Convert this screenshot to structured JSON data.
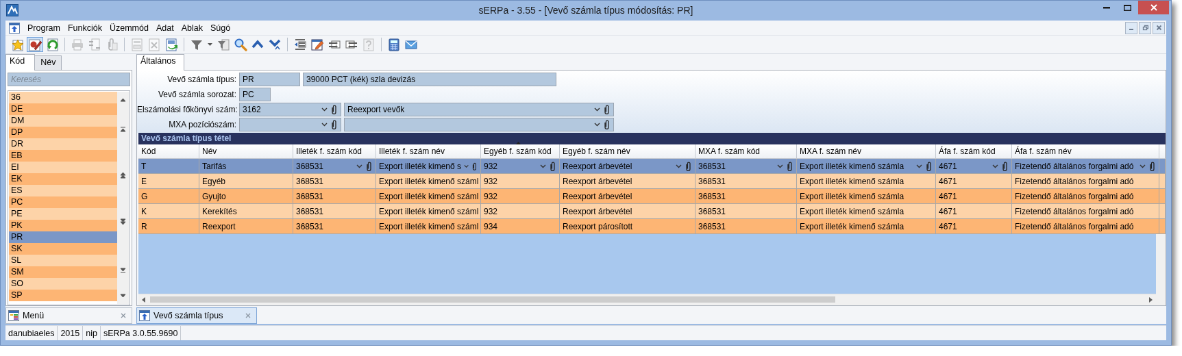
{
  "window": {
    "title": "sERPa - 3.55 - [Vevő számla típus módosítás: PR]"
  },
  "menu": [
    {
      "label": "Program"
    },
    {
      "label": "Funkciók"
    },
    {
      "label": "Üzemmód"
    },
    {
      "label": "Adat"
    },
    {
      "label": "Ablak"
    },
    {
      "label": "Súgó"
    }
  ],
  "toolbar": [
    [
      {
        "kind": "star",
        "disabled": false,
        "pressed": false
      },
      {
        "kind": "edit",
        "disabled": false,
        "pressed": true
      },
      {
        "kind": "refresh",
        "disabled": false,
        "pressed": false
      }
    ],
    [
      {
        "kind": "print",
        "disabled": true,
        "pressed": false
      },
      {
        "kind": "doc-arrows",
        "disabled": true,
        "pressed": false
      },
      {
        "kind": "clip",
        "disabled": true,
        "pressed": false
      }
    ],
    [
      {
        "kind": "form",
        "disabled": true,
        "pressed": false
      },
      {
        "kind": "doc-x",
        "disabled": true,
        "pressed": false
      },
      {
        "kind": "doc-green",
        "disabled": false,
        "pressed": false
      }
    ],
    [
      {
        "kind": "filter",
        "disabled": false,
        "pressed": false
      },
      {
        "kind": "caret",
        "disabled": false,
        "pressed": false
      },
      {
        "kind": "filter-page",
        "disabled": false,
        "pressed": false
      },
      {
        "kind": "search",
        "disabled": false,
        "pressed": false
      },
      {
        "kind": "up",
        "disabled": false,
        "pressed": false
      },
      {
        "kind": "down",
        "disabled": false,
        "pressed": false
      }
    ],
    [
      {
        "kind": "outdent",
        "disabled": false,
        "pressed": false
      },
      {
        "kind": "note",
        "disabled": false,
        "pressed": false
      },
      {
        "kind": "move-in",
        "disabled": false,
        "pressed": false
      },
      {
        "kind": "move-out",
        "disabled": false,
        "pressed": false
      },
      {
        "kind": "help",
        "disabled": true,
        "pressed": false
      }
    ],
    [
      {
        "kind": "calculator",
        "disabled": false,
        "pressed": false
      },
      {
        "kind": "mail",
        "disabled": false,
        "pressed": false
      }
    ]
  ],
  "sidebar": {
    "tabs": [
      {
        "label": "Kód",
        "selected": true
      },
      {
        "label": "Név",
        "selected": false
      }
    ],
    "search": {
      "placeholder": "Keresés"
    },
    "items": [
      {
        "label": "36",
        "selected": false
      },
      {
        "label": "DE",
        "selected": false
      },
      {
        "label": "DM",
        "selected": false
      },
      {
        "label": "DP",
        "selected": false
      },
      {
        "label": "DR",
        "selected": false
      },
      {
        "label": "EB",
        "selected": false
      },
      {
        "label": "EI",
        "selected": false
      },
      {
        "label": "EK",
        "selected": false
      },
      {
        "label": "ES",
        "selected": false
      },
      {
        "label": "PC",
        "selected": false
      },
      {
        "label": "PE",
        "selected": false
      },
      {
        "label": "PK",
        "selected": false
      },
      {
        "label": "PR",
        "selected": true
      },
      {
        "label": "SK",
        "selected": false
      },
      {
        "label": "SL",
        "selected": false
      },
      {
        "label": "SM",
        "selected": false
      },
      {
        "label": "SO",
        "selected": false
      },
      {
        "label": "SP",
        "selected": false
      }
    ]
  },
  "form": {
    "tabs": [
      {
        "label": "Általános",
        "selected": true
      }
    ],
    "fields": [
      {
        "label": "Vevő számla típus:",
        "inputs": [
          {
            "kind": "text",
            "value": "PR"
          },
          {
            "kind": "text",
            "value": "39000 PCT (kék) szla devizás"
          }
        ]
      },
      {
        "label": "Vevő számla sorozat:",
        "inputs": [
          {
            "kind": "text",
            "value": "PC"
          }
        ]
      },
      {
        "label": "Elszámolási főkönyvi szám:",
        "inputs": [
          {
            "kind": "lookup",
            "value": "3162"
          },
          {
            "kind": "lookup",
            "value": "Reexport vevők"
          }
        ]
      },
      {
        "label": "MXA pozíciószám:",
        "inputs": [
          {
            "kind": "lookup"
          },
          {
            "kind": "lookup"
          }
        ]
      }
    ]
  },
  "table": {
    "title": "Vevő számla típus tétel",
    "columns": [
      {
        "label": "Kód",
        "kind": "text",
        "sorted": false
      },
      {
        "label": "Név",
        "kind": "text",
        "sorted": false
      },
      {
        "label": "Illeték f. szám kód",
        "kind": "lookup",
        "sorted": false
      },
      {
        "label": "Illeték f. szám név",
        "kind": "lookup",
        "sorted": false
      },
      {
        "label": "Egyéb f. szám kód",
        "kind": "lookup",
        "sorted": true
      },
      {
        "label": "Egyéb f. szám név",
        "kind": "lookup",
        "sorted": false
      },
      {
        "label": "MXA f. szám kód",
        "kind": "lookup",
        "sorted": false
      },
      {
        "label": "MXA f. szám név",
        "kind": "lookup",
        "sorted": false
      },
      {
        "label": "Áfa f. szám kód",
        "kind": "lookup",
        "sorted": false
      },
      {
        "label": "Áfa f. szám név",
        "kind": "lookup",
        "sorted": false
      }
    ],
    "rows": [
      {
        "selected": true,
        "cells": [
          "T",
          "Tarifás",
          "368531",
          "Export illeték kimenő s",
          "932",
          "Reexport árbevétel",
          "368531",
          "Export illeték kimenő számla",
          "4671",
          "Fizetendő általános forgalmi adó"
        ]
      },
      {
        "selected": false,
        "cells": [
          "E",
          "Egyéb",
          "368531",
          "Export illeték kimenő száml",
          "932",
          "Reexport árbevétel",
          "368531",
          "Export illeték kimenő számla",
          "4671",
          "Fizetendő általános forgalmi adó"
        ]
      },
      {
        "selected": false,
        "cells": [
          "G",
          "Gyujto",
          "368531",
          "Export illeték kimenő száml",
          "932",
          "Reexport árbevétel",
          "368531",
          "Export illeték kimenő számla",
          "4671",
          "Fizetendő általános forgalmi adó"
        ]
      },
      {
        "selected": false,
        "cells": [
          "K",
          "Kerekítés",
          "368531",
          "Export illeték kimenő száml",
          "932",
          "Reexport árbevétel",
          "368531",
          "Export illeték kimenő számla",
          "4671",
          "Fizetendő általános forgalmi adó"
        ]
      },
      {
        "selected": false,
        "cells": [
          "R",
          "Reexport",
          "368531",
          "Export illeték kimenő száml",
          "934",
          "Reexport párosított",
          "368531",
          "Export illeték kimenő számla",
          "4671",
          "Fizetendő általános forgalmi adó"
        ]
      }
    ]
  },
  "document_tabs": [
    {
      "label": "Menü",
      "kind": "menu",
      "selected": false
    },
    {
      "label": "Vevő számla típus",
      "kind": "form",
      "selected": true
    }
  ],
  "status_bar": [
    "danubiaeles",
    "2015",
    "nip",
    "sERPa 3.0.55.9690"
  ]
}
